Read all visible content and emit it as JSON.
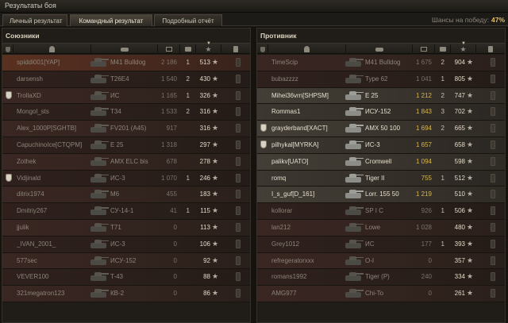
{
  "window": {
    "title": "Результаты боя"
  },
  "tabs": [
    {
      "label": "Личный результат"
    },
    {
      "label": "Командный результат"
    },
    {
      "label": "Подробный отчёт"
    }
  ],
  "win_chance": {
    "label": "Шансы на победу:",
    "value": "47%"
  },
  "allies": {
    "title": "Союзники",
    "rows": [
      {
        "clan": false,
        "name": "spiddi001[YAP]",
        "tank": "M41 Bulldog",
        "damage": "2 186",
        "kills": "1",
        "xp": "513",
        "alive": false,
        "highlight": true
      },
      {
        "clan": false,
        "name": "darsensh",
        "tank": "T26E4",
        "damage": "1 540",
        "kills": "2",
        "xp": "430",
        "alive": false
      },
      {
        "clan": true,
        "name": "TrollaXD",
        "tank": "ИС",
        "damage": "1 165",
        "kills": "1",
        "xp": "326",
        "alive": false
      },
      {
        "clan": false,
        "name": "Mongol_sts",
        "tank": "T34",
        "damage": "1 533",
        "kills": "2",
        "xp": "316",
        "alive": false
      },
      {
        "clan": false,
        "name": "Alex_1000P[SGHTB]",
        "tank": "FV201 (A45)",
        "damage": "917",
        "kills": "",
        "xp": "316",
        "alive": false
      },
      {
        "clan": false,
        "name": "CapuchinoIce[CTQPM]",
        "tank": "E 25",
        "damage": "1 318",
        "kills": "",
        "xp": "297",
        "alive": false
      },
      {
        "clan": false,
        "name": "Zothek",
        "tank": "AMX ELC bis",
        "damage": "678",
        "kills": "",
        "xp": "278",
        "alive": false
      },
      {
        "clan": true,
        "name": "Vidjinald",
        "tank": "ИС-3",
        "damage": "1 070",
        "kills": "1",
        "xp": "246",
        "alive": false
      },
      {
        "clan": false,
        "name": "ditrix1974",
        "tank": "M6",
        "damage": "455",
        "kills": "",
        "xp": "183",
        "alive": false
      },
      {
        "clan": false,
        "name": "Dmitriy267",
        "tank": "СУ-14-1",
        "damage": "41",
        "kills": "1",
        "xp": "115",
        "alive": false
      },
      {
        "clan": false,
        "name": "jjulik",
        "tank": "T71",
        "damage": "0",
        "kills": "",
        "xp": "113",
        "alive": false
      },
      {
        "clan": false,
        "name": "_IVAN_2001_",
        "tank": "ИС-3",
        "damage": "0",
        "kills": "",
        "xp": "106",
        "alive": false
      },
      {
        "clan": false,
        "name": "577sec",
        "tank": "ИСУ-152",
        "damage": "0",
        "kills": "",
        "xp": "92",
        "alive": false
      },
      {
        "clan": false,
        "name": "VEVER100",
        "tank": "T-43",
        "damage": "0",
        "kills": "",
        "xp": "88",
        "alive": false
      },
      {
        "clan": false,
        "name": "321megatron123",
        "tank": "КВ-2",
        "damage": "0",
        "kills": "",
        "xp": "86",
        "alive": false
      }
    ]
  },
  "enemies": {
    "title": "Противник",
    "rows": [
      {
        "clan": false,
        "name": "TimeScip",
        "tank": "M41 Bulldog",
        "damage": "1 675",
        "kills": "2",
        "xp": "904",
        "alive": false
      },
      {
        "clan": false,
        "name": "bubazzzz",
        "tank": "Type 62",
        "damage": "1 041",
        "kills": "1",
        "xp": "805",
        "alive": false
      },
      {
        "clan": false,
        "name": "Mihei36vrn[SHPSM]",
        "tank": "E 25",
        "damage": "1 212",
        "kills": "2",
        "xp": "747",
        "alive": true
      },
      {
        "clan": false,
        "name": "Rommas1",
        "tank": "ИСУ-152",
        "damage": "1 843",
        "kills": "3",
        "xp": "702",
        "alive": true
      },
      {
        "clan": true,
        "name": "grayderband[XACT]",
        "tank": "AMX 50 100",
        "damage": "1 694",
        "kills": "2",
        "xp": "665",
        "alive": true
      },
      {
        "clan": true,
        "name": "pilhykal[MYRKA]",
        "tank": "ИС-3",
        "damage": "1 657",
        "kills": "",
        "xp": "658",
        "alive": true
      },
      {
        "clan": false,
        "name": "palikv[UATO]",
        "tank": "Cromwell",
        "damage": "1 094",
        "kills": "",
        "xp": "598",
        "alive": true
      },
      {
        "clan": false,
        "name": "romq",
        "tank": "Tiger II",
        "damage": "755",
        "kills": "1",
        "xp": "512",
        "alive": true
      },
      {
        "clan": false,
        "name": "I_s_guf[D_161]",
        "tank": "Lorr. 155 50",
        "damage": "1 219",
        "kills": "",
        "xp": "510",
        "alive": true
      },
      {
        "clan": false,
        "name": "kollorar",
        "tank": "SP I C",
        "damage": "926",
        "kills": "1",
        "xp": "506",
        "alive": false
      },
      {
        "clan": false,
        "name": "lan212",
        "tank": "Lowe",
        "damage": "1 028",
        "kills": "",
        "xp": "480",
        "alive": false
      },
      {
        "clan": false,
        "name": "Grey1012",
        "tank": "ИС",
        "damage": "177",
        "kills": "1",
        "xp": "393",
        "alive": false
      },
      {
        "clan": false,
        "name": "refregeratorxxx",
        "tank": "O-I",
        "damage": "0",
        "kills": "",
        "xp": "357",
        "alive": false
      },
      {
        "clan": false,
        "name": "romans1992",
        "tank": "Tiger (P)",
        "damage": "240",
        "kills": "",
        "xp": "334",
        "alive": false
      },
      {
        "clan": false,
        "name": "AMG977",
        "tank": "Chi-To",
        "damage": "0",
        "kills": "",
        "xp": "261",
        "alive": false
      }
    ]
  },
  "colors": {
    "win_chance": "#e0c060",
    "damage_alive": "#d7b650"
  },
  "icons": {
    "header": [
      "squad-icon",
      "player-icon",
      "tank-icon",
      "tier-icon",
      "kills-icon",
      "xp-star-icon",
      "medal-icon"
    ],
    "row": [
      "clan-icon",
      "tank-image-icon",
      "star-icon",
      "medal-icon"
    ]
  }
}
